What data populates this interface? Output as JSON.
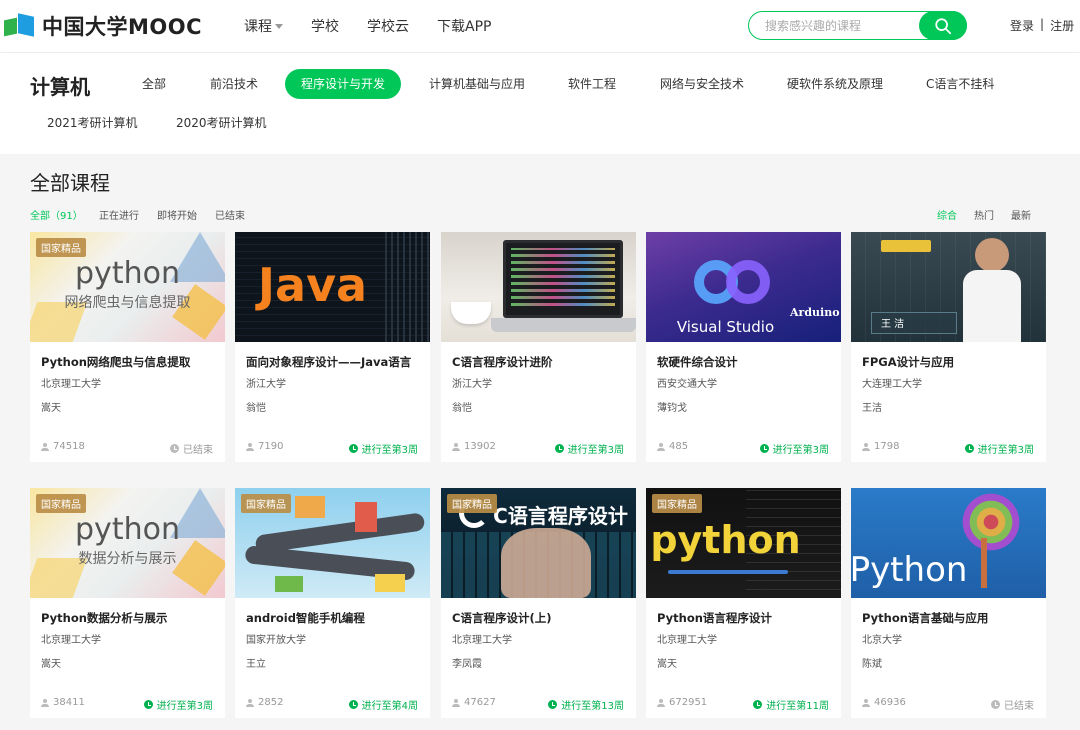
{
  "header": {
    "logo_text": "中国大学MOOC",
    "nav": [
      {
        "label": "课程",
        "has_caret": true
      },
      {
        "label": "学校"
      },
      {
        "label": "学校云"
      },
      {
        "label": "下载APP"
      }
    ],
    "search_placeholder": "搜索感兴趣的课程",
    "login": "登录",
    "auth_sep": "|",
    "register": "注册"
  },
  "category": {
    "title": "计算机",
    "tags": [
      "全部",
      "前沿技术",
      "程序设计与开发",
      "计算机基础与应用",
      "软件工程",
      "网络与安全技术",
      "硬软件系统及原理",
      "C语言不挂科",
      "2021考研计算机",
      "2020考研计算机"
    ],
    "active_index": 2
  },
  "section": {
    "title": "全部课程",
    "filters": [
      "全部（91）",
      "正在进行",
      "即将开始",
      "已结束"
    ],
    "sorts": [
      "综合",
      "热门",
      "最新"
    ]
  },
  "colors": {
    "accent": "#00c758",
    "badge": "#ba8d46"
  },
  "courses": [
    {
      "title": "Python网络爬虫与信息提取",
      "school": "北京理工大学",
      "teacher": "嵩天",
      "count": "74518",
      "status": "已结束",
      "state": "done",
      "badge": "国家精品",
      "thumb_main": "python",
      "thumb_sub": "网络爬虫与信息提取"
    },
    {
      "title": "面向对象程序设计——Java语言",
      "school": "浙江大学",
      "teacher": "翁恺",
      "count": "7190",
      "status": "进行至第3周",
      "state": "live",
      "badge": "",
      "thumb_main": "Java",
      "thumb_sub": ""
    },
    {
      "title": "C语言程序设计进阶",
      "school": "浙江大学",
      "teacher": "翁恺",
      "count": "13902",
      "status": "进行至第3周",
      "state": "live",
      "badge": "",
      "thumb_main": "",
      "thumb_sub": ""
    },
    {
      "title": "软硬件综合设计",
      "school": "西安交通大学",
      "teacher": "薄钧戈",
      "count": "485",
      "status": "进行至第3周",
      "state": "live",
      "badge": "",
      "thumb_main": "Visual Studio",
      "thumb_sub": "Arduino"
    },
    {
      "title": "FPGA设计与应用",
      "school": "大连理工大学",
      "teacher": "王洁",
      "count": "1798",
      "status": "进行至第3周",
      "state": "live",
      "badge": "",
      "thumb_main": "王 洁",
      "thumb_sub": ""
    },
    {
      "title": "Python数据分析与展示",
      "school": "北京理工大学",
      "teacher": "嵩天",
      "count": "38411",
      "status": "进行至第3周",
      "state": "live",
      "badge": "国家精品",
      "thumb_main": "python",
      "thumb_sub": "数据分析与展示"
    },
    {
      "title": "android智能手机编程",
      "school": "国家开放大学",
      "teacher": "王立",
      "count": "2852",
      "status": "进行至第4周",
      "state": "live",
      "badge": "国家精品",
      "thumb_main": "",
      "thumb_sub": ""
    },
    {
      "title": "C语言程序设计(上)",
      "school": "北京理工大学",
      "teacher": "李凤霞",
      "count": "47627",
      "status": "进行至第13周",
      "state": "live",
      "badge": "国家精品",
      "thumb_main": "C语言程序设计",
      "thumb_sub": ""
    },
    {
      "title": "Python语言程序设计",
      "school": "北京理工大学",
      "teacher": "嵩天",
      "count": "672951",
      "status": "进行至第11周",
      "state": "live",
      "badge": "国家精品",
      "thumb_main": "python",
      "thumb_sub": ""
    },
    {
      "title": "Python语言基础与应用",
      "school": "北京大学",
      "teacher": "陈斌",
      "count": "46936",
      "status": "已结束",
      "state": "done",
      "badge": "",
      "thumb_main": "Python",
      "thumb_sub": ""
    }
  ]
}
